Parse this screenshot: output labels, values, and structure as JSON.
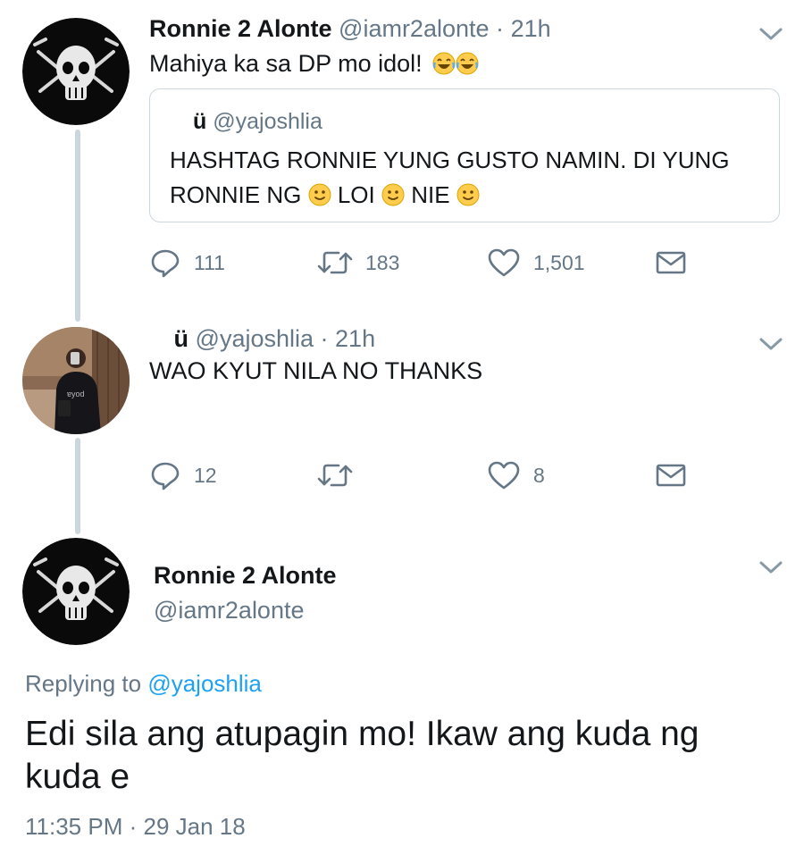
{
  "tweet1": {
    "name": "Ronnie 2 Alonte",
    "handle": "@iamr2alonte",
    "separator": "·",
    "time": "21h",
    "text": "Mahiya ka sa DP mo idol!",
    "text_emoji": "tears-of-joy-emoji",
    "quote": {
      "name": "ü",
      "handle": "@yajoshlia",
      "line1": "HASHTAG RONNIE YUNG GUSTO NAMIN. DI YUNG",
      "line2_parts": [
        "RONNIE NG",
        "LOI",
        "NIE"
      ],
      "emoji": "slightly-smiling-face-emoji"
    },
    "actions": {
      "replies": "111",
      "retweets": "183",
      "likes": "1,501"
    }
  },
  "tweet2": {
    "name": "ü",
    "handle": "@yajoshlia",
    "separator": "·",
    "time": "21h",
    "text": "WAO KYUT NILA NO THANKS",
    "actions": {
      "replies": "12",
      "retweets": "",
      "likes": "8"
    }
  },
  "tweet3": {
    "name": "Ronnie 2 Alonte",
    "handle": "@iamr2alonte",
    "replying_label": "Replying to",
    "replying_handle": "@yajoshlia",
    "text": "Edi sila ang atupagin mo! Ikaw ang kuda ng kuda e",
    "timestamp_time": "11:35 PM",
    "separator": "·",
    "timestamp_date": "29 Jan 18"
  },
  "icons": {
    "reply": "reply-icon",
    "retweet": "retweet-icon",
    "like": "heart-icon",
    "dm": "envelope-icon",
    "more": "chevron-down-icon"
  },
  "colors": {
    "text": "#14171a",
    "secondary": "#657786",
    "link": "#1da1f2",
    "thread_line": "#ccd6dd"
  }
}
